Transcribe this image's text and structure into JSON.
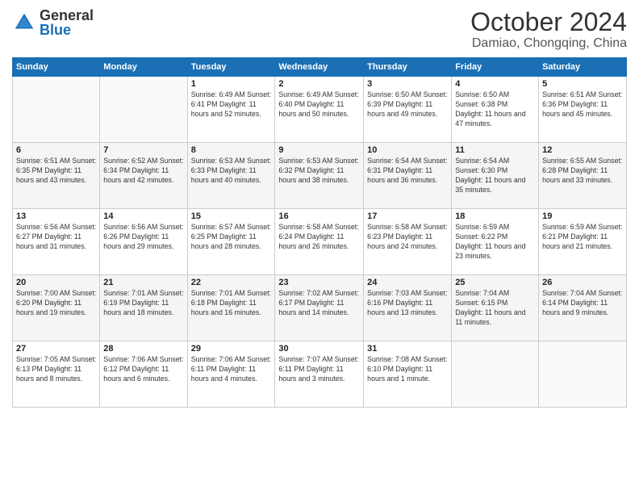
{
  "logo": {
    "general": "General",
    "blue": "Blue"
  },
  "header": {
    "month": "October 2024",
    "location": "Damiao, Chongqing, China"
  },
  "weekdays": [
    "Sunday",
    "Monday",
    "Tuesday",
    "Wednesday",
    "Thursday",
    "Friday",
    "Saturday"
  ],
  "weeks": [
    [
      {
        "day": "",
        "info": ""
      },
      {
        "day": "",
        "info": ""
      },
      {
        "day": "1",
        "info": "Sunrise: 6:49 AM\nSunset: 6:41 PM\nDaylight: 11 hours and 52 minutes."
      },
      {
        "day": "2",
        "info": "Sunrise: 6:49 AM\nSunset: 6:40 PM\nDaylight: 11 hours and 50 minutes."
      },
      {
        "day": "3",
        "info": "Sunrise: 6:50 AM\nSunset: 6:39 PM\nDaylight: 11 hours and 49 minutes."
      },
      {
        "day": "4",
        "info": "Sunrise: 6:50 AM\nSunset: 6:38 PM\nDaylight: 11 hours and 47 minutes."
      },
      {
        "day": "5",
        "info": "Sunrise: 6:51 AM\nSunset: 6:36 PM\nDaylight: 11 hours and 45 minutes."
      }
    ],
    [
      {
        "day": "6",
        "info": "Sunrise: 6:51 AM\nSunset: 6:35 PM\nDaylight: 11 hours and 43 minutes."
      },
      {
        "day": "7",
        "info": "Sunrise: 6:52 AM\nSunset: 6:34 PM\nDaylight: 11 hours and 42 minutes."
      },
      {
        "day": "8",
        "info": "Sunrise: 6:53 AM\nSunset: 6:33 PM\nDaylight: 11 hours and 40 minutes."
      },
      {
        "day": "9",
        "info": "Sunrise: 6:53 AM\nSunset: 6:32 PM\nDaylight: 11 hours and 38 minutes."
      },
      {
        "day": "10",
        "info": "Sunrise: 6:54 AM\nSunset: 6:31 PM\nDaylight: 11 hours and 36 minutes."
      },
      {
        "day": "11",
        "info": "Sunrise: 6:54 AM\nSunset: 6:30 PM\nDaylight: 11 hours and 35 minutes."
      },
      {
        "day": "12",
        "info": "Sunrise: 6:55 AM\nSunset: 6:28 PM\nDaylight: 11 hours and 33 minutes."
      }
    ],
    [
      {
        "day": "13",
        "info": "Sunrise: 6:56 AM\nSunset: 6:27 PM\nDaylight: 11 hours and 31 minutes."
      },
      {
        "day": "14",
        "info": "Sunrise: 6:56 AM\nSunset: 6:26 PM\nDaylight: 11 hours and 29 minutes."
      },
      {
        "day": "15",
        "info": "Sunrise: 6:57 AM\nSunset: 6:25 PM\nDaylight: 11 hours and 28 minutes."
      },
      {
        "day": "16",
        "info": "Sunrise: 6:58 AM\nSunset: 6:24 PM\nDaylight: 11 hours and 26 minutes."
      },
      {
        "day": "17",
        "info": "Sunrise: 6:58 AM\nSunset: 6:23 PM\nDaylight: 11 hours and 24 minutes."
      },
      {
        "day": "18",
        "info": "Sunrise: 6:59 AM\nSunset: 6:22 PM\nDaylight: 11 hours and 23 minutes."
      },
      {
        "day": "19",
        "info": "Sunrise: 6:59 AM\nSunset: 6:21 PM\nDaylight: 11 hours and 21 minutes."
      }
    ],
    [
      {
        "day": "20",
        "info": "Sunrise: 7:00 AM\nSunset: 6:20 PM\nDaylight: 11 hours and 19 minutes."
      },
      {
        "day": "21",
        "info": "Sunrise: 7:01 AM\nSunset: 6:19 PM\nDaylight: 11 hours and 18 minutes."
      },
      {
        "day": "22",
        "info": "Sunrise: 7:01 AM\nSunset: 6:18 PM\nDaylight: 11 hours and 16 minutes."
      },
      {
        "day": "23",
        "info": "Sunrise: 7:02 AM\nSunset: 6:17 PM\nDaylight: 11 hours and 14 minutes."
      },
      {
        "day": "24",
        "info": "Sunrise: 7:03 AM\nSunset: 6:16 PM\nDaylight: 11 hours and 13 minutes."
      },
      {
        "day": "25",
        "info": "Sunrise: 7:04 AM\nSunset: 6:15 PM\nDaylight: 11 hours and 11 minutes."
      },
      {
        "day": "26",
        "info": "Sunrise: 7:04 AM\nSunset: 6:14 PM\nDaylight: 11 hours and 9 minutes."
      }
    ],
    [
      {
        "day": "27",
        "info": "Sunrise: 7:05 AM\nSunset: 6:13 PM\nDaylight: 11 hours and 8 minutes."
      },
      {
        "day": "28",
        "info": "Sunrise: 7:06 AM\nSunset: 6:12 PM\nDaylight: 11 hours and 6 minutes."
      },
      {
        "day": "29",
        "info": "Sunrise: 7:06 AM\nSunset: 6:11 PM\nDaylight: 11 hours and 4 minutes."
      },
      {
        "day": "30",
        "info": "Sunrise: 7:07 AM\nSunset: 6:11 PM\nDaylight: 11 hours and 3 minutes."
      },
      {
        "day": "31",
        "info": "Sunrise: 7:08 AM\nSunset: 6:10 PM\nDaylight: 11 hours and 1 minute."
      },
      {
        "day": "",
        "info": ""
      },
      {
        "day": "",
        "info": ""
      }
    ]
  ]
}
